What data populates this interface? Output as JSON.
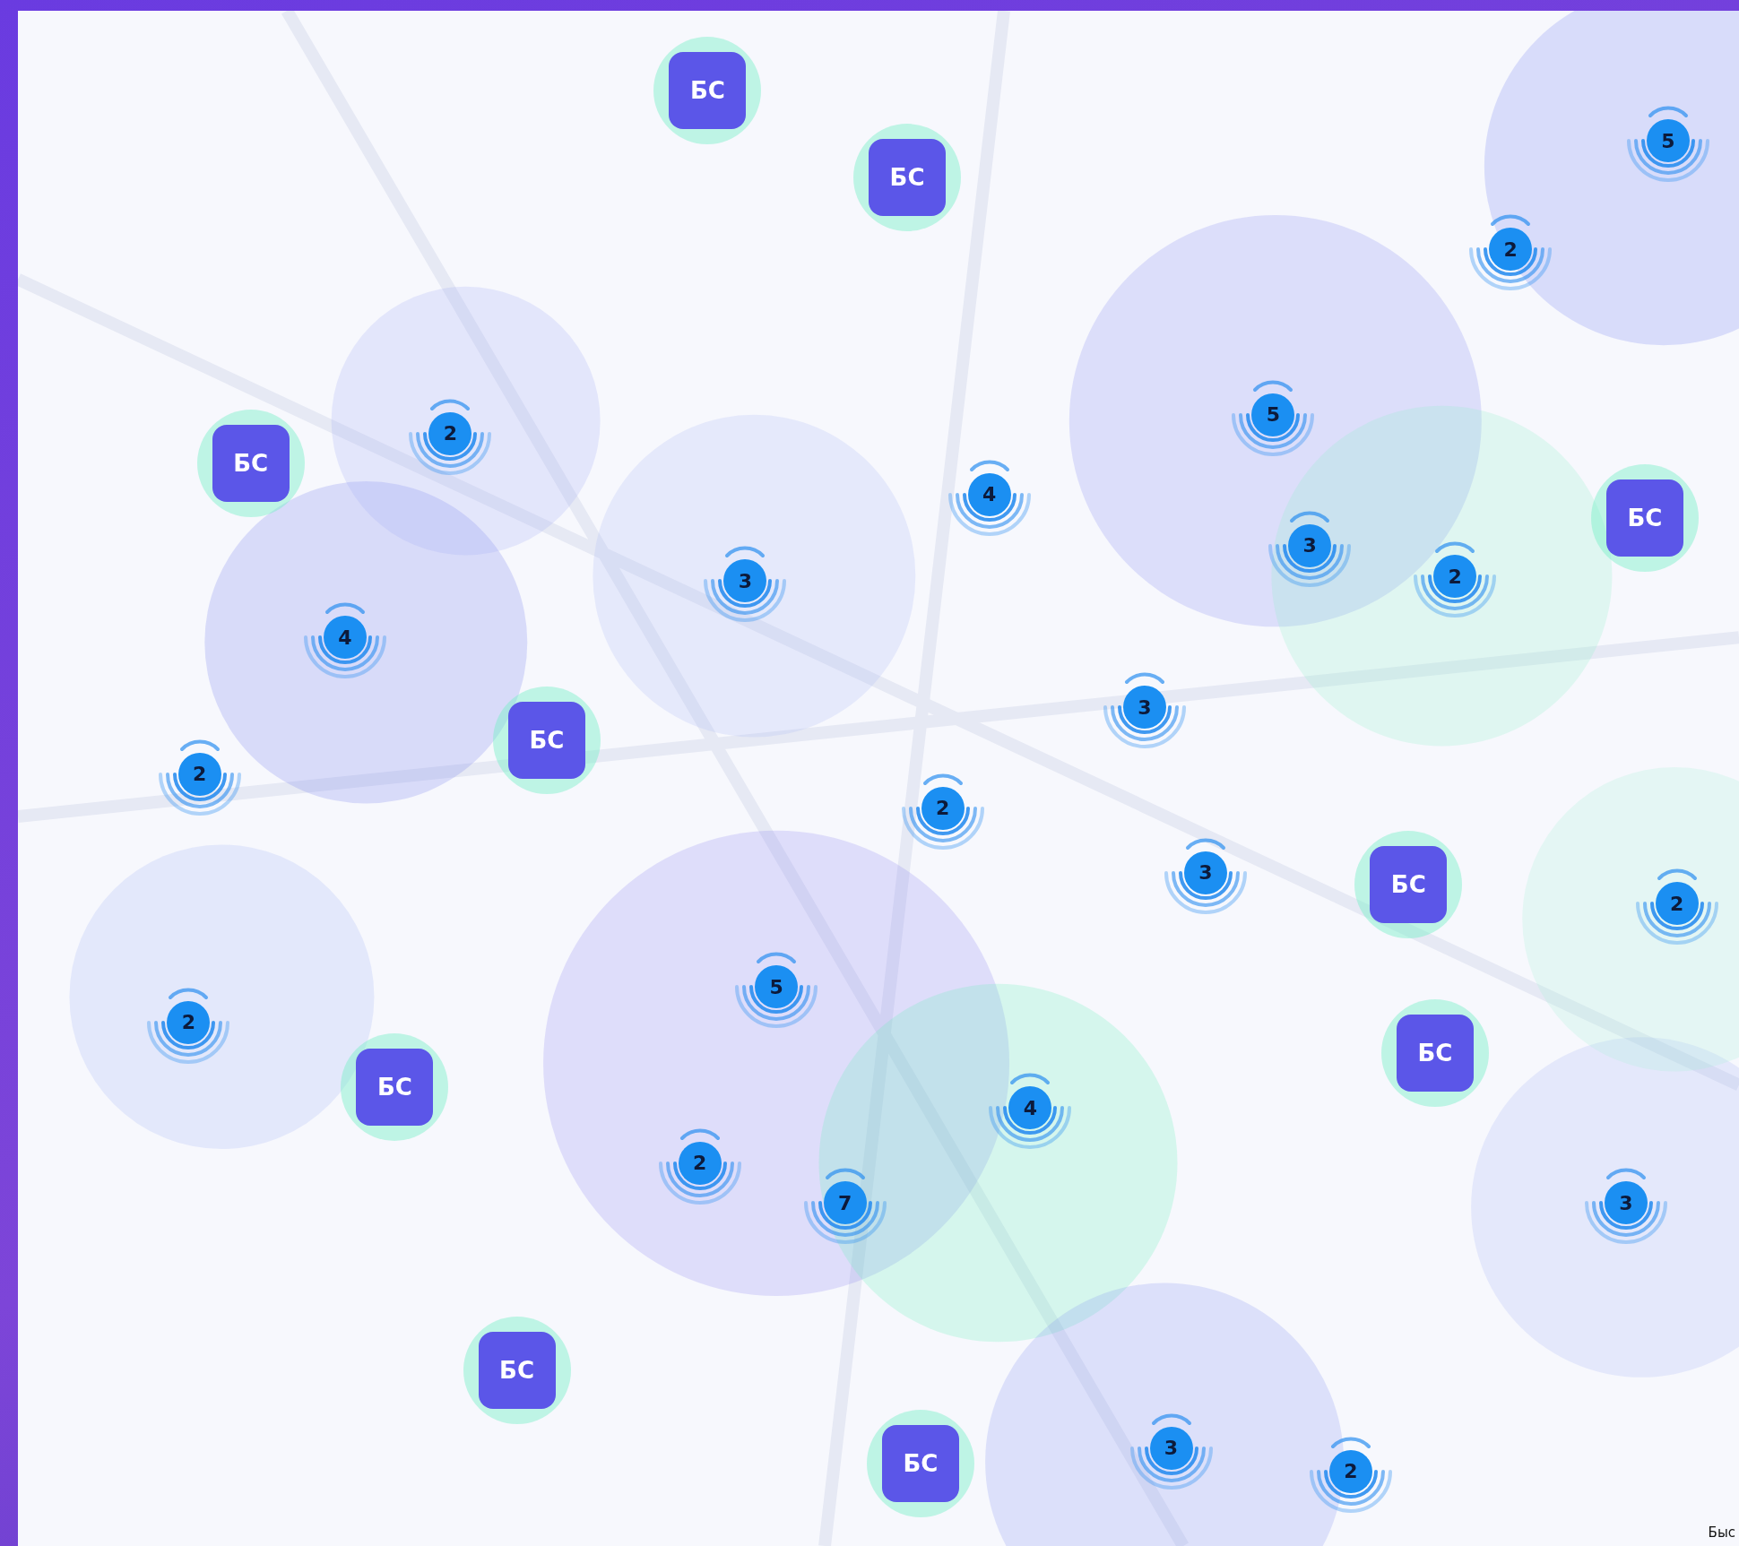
{
  "map": {
    "markers": [
      {
        "kind": "station",
        "label": "БС"
      },
      {
        "kind": "station",
        "label": "БС"
      },
      {
        "kind": "station",
        "label": "БС"
      },
      {
        "kind": "station",
        "label": "БС"
      },
      {
        "kind": "station",
        "label": "БС"
      },
      {
        "kind": "station",
        "label": "БС"
      },
      {
        "kind": "station",
        "label": "БС"
      },
      {
        "kind": "station",
        "label": "БС"
      },
      {
        "kind": "station",
        "label": "БС"
      },
      {
        "kind": "station",
        "label": "БС"
      },
      {
        "kind": "cluster",
        "label": "2"
      },
      {
        "kind": "cluster",
        "label": "5"
      },
      {
        "kind": "cluster",
        "label": "2"
      },
      {
        "kind": "cluster",
        "label": "5"
      },
      {
        "kind": "cluster",
        "label": "4"
      },
      {
        "kind": "cluster",
        "label": "3"
      },
      {
        "kind": "cluster",
        "label": "3"
      },
      {
        "kind": "cluster",
        "label": "2"
      },
      {
        "kind": "cluster",
        "label": "4"
      },
      {
        "kind": "cluster",
        "label": "3"
      },
      {
        "kind": "cluster",
        "label": "2"
      },
      {
        "kind": "cluster",
        "label": "2"
      },
      {
        "kind": "cluster",
        "label": "3"
      },
      {
        "kind": "cluster",
        "label": "2"
      },
      {
        "kind": "cluster",
        "label": "5"
      },
      {
        "kind": "cluster",
        "label": "2"
      },
      {
        "kind": "cluster",
        "label": "4"
      },
      {
        "kind": "cluster",
        "label": "2"
      },
      {
        "kind": "cluster",
        "label": "7"
      },
      {
        "kind": "cluster",
        "label": "3"
      },
      {
        "kind": "cluster",
        "label": "3"
      },
      {
        "kind": "cluster",
        "label": "2"
      }
    ],
    "attribution": "Быс"
  }
}
